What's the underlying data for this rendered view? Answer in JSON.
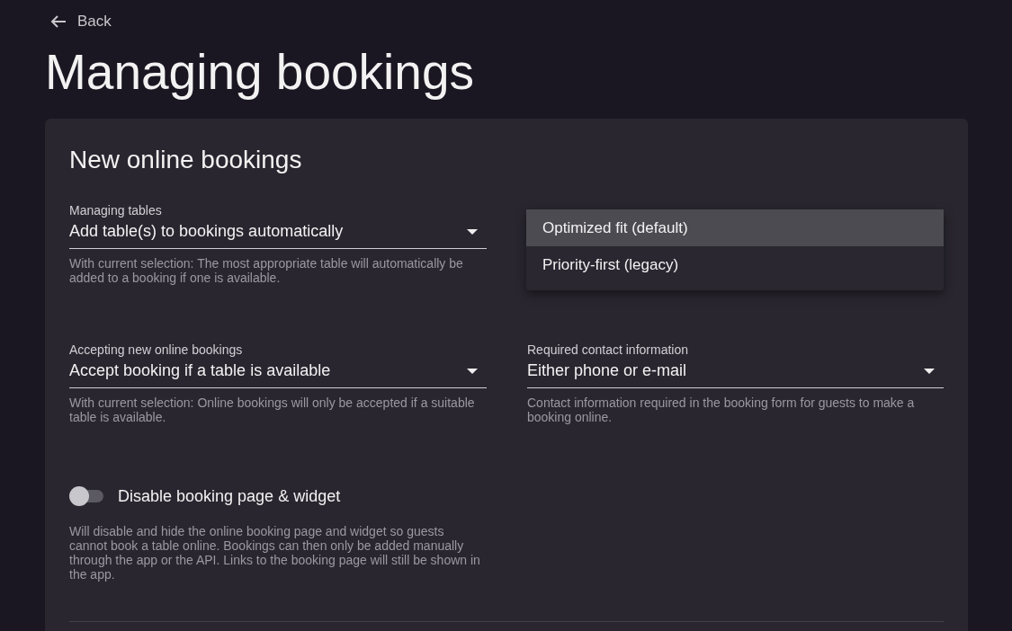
{
  "back": {
    "label": "Back"
  },
  "title": "Managing bookings",
  "card": {
    "title": "New online bookings",
    "fields": [
      {
        "label": "Managing tables",
        "value": "Add table(s) to bookings automatically",
        "helper": "With current selection: The most appropriate table will automatically be added to a booking if one is available."
      },
      {
        "label": "Accepting new online bookings",
        "value": "Accept booking if a table is available",
        "helper": "With current selection: Online bookings will only be accepted if a suitable table is available."
      },
      {
        "label": "Required contact information",
        "value": "Either phone or e-mail",
        "helper": "Contact information required in the booking form for guests to make a booking online."
      }
    ],
    "menu": {
      "options": [
        {
          "label": "Optimized fit (default)",
          "selected": true
        },
        {
          "label": "Priority-first (legacy)",
          "selected": false
        }
      ]
    },
    "toggle": {
      "label": "Disable booking page & widget",
      "on": false,
      "helper": "Will disable and hide the online booking page and widget so guests cannot book a table online. Bookings can then only be added manually through the app or the API. Links to the booking page will still be shown in the app."
    }
  }
}
